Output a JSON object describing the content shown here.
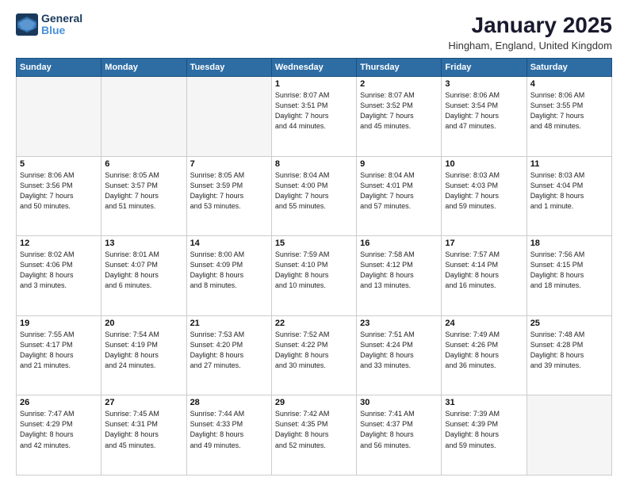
{
  "header": {
    "logo_line1": "General",
    "logo_line2": "Blue",
    "month": "January 2025",
    "location": "Hingham, England, United Kingdom"
  },
  "weekdays": [
    "Sunday",
    "Monday",
    "Tuesday",
    "Wednesday",
    "Thursday",
    "Friday",
    "Saturday"
  ],
  "weeks": [
    [
      {
        "day": "",
        "info": ""
      },
      {
        "day": "",
        "info": ""
      },
      {
        "day": "",
        "info": ""
      },
      {
        "day": "1",
        "info": "Sunrise: 8:07 AM\nSunset: 3:51 PM\nDaylight: 7 hours\nand 44 minutes."
      },
      {
        "day": "2",
        "info": "Sunrise: 8:07 AM\nSunset: 3:52 PM\nDaylight: 7 hours\nand 45 minutes."
      },
      {
        "day": "3",
        "info": "Sunrise: 8:06 AM\nSunset: 3:54 PM\nDaylight: 7 hours\nand 47 minutes."
      },
      {
        "day": "4",
        "info": "Sunrise: 8:06 AM\nSunset: 3:55 PM\nDaylight: 7 hours\nand 48 minutes."
      }
    ],
    [
      {
        "day": "5",
        "info": "Sunrise: 8:06 AM\nSunset: 3:56 PM\nDaylight: 7 hours\nand 50 minutes."
      },
      {
        "day": "6",
        "info": "Sunrise: 8:05 AM\nSunset: 3:57 PM\nDaylight: 7 hours\nand 51 minutes."
      },
      {
        "day": "7",
        "info": "Sunrise: 8:05 AM\nSunset: 3:59 PM\nDaylight: 7 hours\nand 53 minutes."
      },
      {
        "day": "8",
        "info": "Sunrise: 8:04 AM\nSunset: 4:00 PM\nDaylight: 7 hours\nand 55 minutes."
      },
      {
        "day": "9",
        "info": "Sunrise: 8:04 AM\nSunset: 4:01 PM\nDaylight: 7 hours\nand 57 minutes."
      },
      {
        "day": "10",
        "info": "Sunrise: 8:03 AM\nSunset: 4:03 PM\nDaylight: 7 hours\nand 59 minutes."
      },
      {
        "day": "11",
        "info": "Sunrise: 8:03 AM\nSunset: 4:04 PM\nDaylight: 8 hours\nand 1 minute."
      }
    ],
    [
      {
        "day": "12",
        "info": "Sunrise: 8:02 AM\nSunset: 4:06 PM\nDaylight: 8 hours\nand 3 minutes."
      },
      {
        "day": "13",
        "info": "Sunrise: 8:01 AM\nSunset: 4:07 PM\nDaylight: 8 hours\nand 6 minutes."
      },
      {
        "day": "14",
        "info": "Sunrise: 8:00 AM\nSunset: 4:09 PM\nDaylight: 8 hours\nand 8 minutes."
      },
      {
        "day": "15",
        "info": "Sunrise: 7:59 AM\nSunset: 4:10 PM\nDaylight: 8 hours\nand 10 minutes."
      },
      {
        "day": "16",
        "info": "Sunrise: 7:58 AM\nSunset: 4:12 PM\nDaylight: 8 hours\nand 13 minutes."
      },
      {
        "day": "17",
        "info": "Sunrise: 7:57 AM\nSunset: 4:14 PM\nDaylight: 8 hours\nand 16 minutes."
      },
      {
        "day": "18",
        "info": "Sunrise: 7:56 AM\nSunset: 4:15 PM\nDaylight: 8 hours\nand 18 minutes."
      }
    ],
    [
      {
        "day": "19",
        "info": "Sunrise: 7:55 AM\nSunset: 4:17 PM\nDaylight: 8 hours\nand 21 minutes."
      },
      {
        "day": "20",
        "info": "Sunrise: 7:54 AM\nSunset: 4:19 PM\nDaylight: 8 hours\nand 24 minutes."
      },
      {
        "day": "21",
        "info": "Sunrise: 7:53 AM\nSunset: 4:20 PM\nDaylight: 8 hours\nand 27 minutes."
      },
      {
        "day": "22",
        "info": "Sunrise: 7:52 AM\nSunset: 4:22 PM\nDaylight: 8 hours\nand 30 minutes."
      },
      {
        "day": "23",
        "info": "Sunrise: 7:51 AM\nSunset: 4:24 PM\nDaylight: 8 hours\nand 33 minutes."
      },
      {
        "day": "24",
        "info": "Sunrise: 7:49 AM\nSunset: 4:26 PM\nDaylight: 8 hours\nand 36 minutes."
      },
      {
        "day": "25",
        "info": "Sunrise: 7:48 AM\nSunset: 4:28 PM\nDaylight: 8 hours\nand 39 minutes."
      }
    ],
    [
      {
        "day": "26",
        "info": "Sunrise: 7:47 AM\nSunset: 4:29 PM\nDaylight: 8 hours\nand 42 minutes."
      },
      {
        "day": "27",
        "info": "Sunrise: 7:45 AM\nSunset: 4:31 PM\nDaylight: 8 hours\nand 45 minutes."
      },
      {
        "day": "28",
        "info": "Sunrise: 7:44 AM\nSunset: 4:33 PM\nDaylight: 8 hours\nand 49 minutes."
      },
      {
        "day": "29",
        "info": "Sunrise: 7:42 AM\nSunset: 4:35 PM\nDaylight: 8 hours\nand 52 minutes."
      },
      {
        "day": "30",
        "info": "Sunrise: 7:41 AM\nSunset: 4:37 PM\nDaylight: 8 hours\nand 56 minutes."
      },
      {
        "day": "31",
        "info": "Sunrise: 7:39 AM\nSunset: 4:39 PM\nDaylight: 8 hours\nand 59 minutes."
      },
      {
        "day": "",
        "info": ""
      }
    ]
  ]
}
